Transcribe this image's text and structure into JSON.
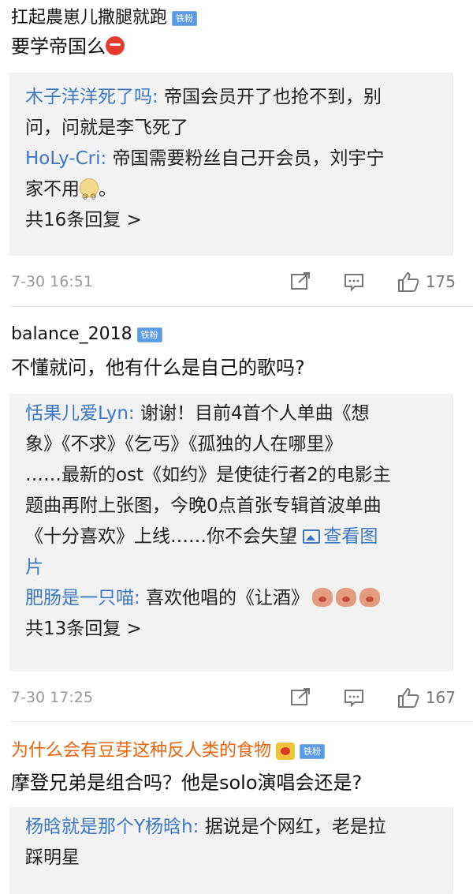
{
  "comments": [
    {
      "username": "扛起農崽儿撒腿就跑",
      "badge": "铁粉",
      "text": "要学帝国么",
      "emoji": "angry-face-emoji",
      "replies": [
        {
          "name": "木子洋洋死了吗:",
          "text_line1": " 帝国会员开了也抢不到，别",
          "text_line2": "问，问就是李飞死了"
        },
        {
          "name": "HoLy-Cri:",
          "text_line1": " 帝国需要粉丝自己开会员，刘宇宁",
          "text_line2": "家不用",
          "text_tail": "。"
        }
      ],
      "more_replies": "共16条回复 >",
      "time": "7-30 16:51",
      "likes": "175"
    },
    {
      "username": "balance_2018",
      "badge": "铁粉",
      "text": "不懂就问，他有什么是自己的歌吗?",
      "replies": [
        {
          "name": "恬果儿爱Lyn:",
          "lines": [
            " 谢谢！目前4首个人单曲《想",
            "象》《不求》《乞丐》《孤独的人在哪里》",
            "……最新的ost《如约》是使徒行者2的电影主",
            "题曲再附上张图，今晚0点首张专辑首波单曲",
            "《十分喜欢》上线……你不会失望 "
          ],
          "view_image": "查看图",
          "view_image_line2": "片"
        },
        {
          "name": "肥肠是一只喵:",
          "text_line1": " 喜欢他唱的《让酒》"
        }
      ],
      "more_replies": "共13条回复 >",
      "time": "7-30 17:25",
      "likes": "167"
    },
    {
      "username": "为什么会有豆芽这种反人类的食物",
      "badge": "铁粉",
      "text": "摩登兄弟是组合吗？他是solo演唱会还是?",
      "replies": [
        {
          "name": "杨晗就是那个Y杨晗h:",
          "text_line1": " 据说是个网红，老是拉",
          "text_line2": "踩明星"
        }
      ]
    }
  ],
  "colors": {
    "link": "#3b77c2",
    "vip_name": "#e8630a",
    "reply_bg": "#f2f2f2",
    "meta": "#9a9a9a"
  }
}
